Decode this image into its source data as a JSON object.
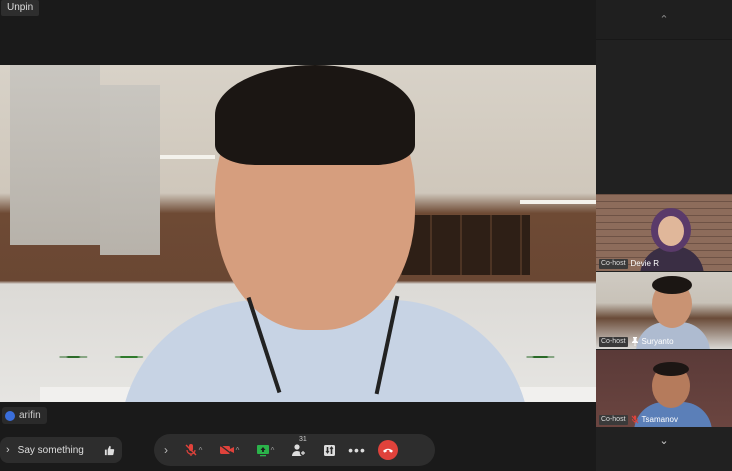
{
  "main": {
    "unpin_label": "Unpin",
    "speaker_name": "arifin"
  },
  "chat": {
    "placeholder": "Say something"
  },
  "toolbar": {
    "participant_count": "31"
  },
  "sidebar": {
    "tiles": [
      {
        "role": "Co-host",
        "name": "Devie R"
      },
      {
        "role": "Co-host",
        "name": "Suryanto"
      },
      {
        "role": "Co-host",
        "name": "Tsamanov"
      }
    ]
  },
  "colors": {
    "accent_blue": "#3a6edb",
    "leave_red": "#e0423b",
    "muted_red": "#e0423b",
    "share_green": "#2bb34a"
  }
}
